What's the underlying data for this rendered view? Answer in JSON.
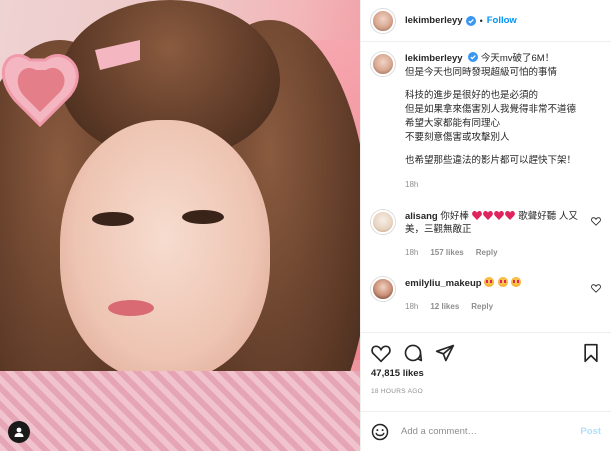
{
  "post": {
    "username": "lekimberleyy",
    "follow_label": "Follow",
    "separator": "•"
  },
  "caption": {
    "username": "lekimberleyy",
    "lines": [
      "今天mv破了6M！",
      "但是今天也同時發現超級可怕的事情",
      "",
      "科技的進步是很好的也是必須的",
      "但是如果拿來傷害別人我覺得非常不道德",
      "希望大家都能有同理心",
      "不要刻意傷害或攻擊別人",
      "",
      "也希望那些違法的影片都可以趕快下架！"
    ],
    "time": "18h"
  },
  "comments": [
    {
      "username": "alisang",
      "text_before": "你好棒",
      "text_after": "歌聲好聽 人又美，三觀無敵正",
      "time": "18h",
      "likes": "157 likes",
      "reply": "Reply"
    },
    {
      "username": "emilyliu_makeup",
      "text": "",
      "time": "18h",
      "likes": "12 likes",
      "reply": "Reply"
    }
  ],
  "stats": {
    "likes": "47,815 likes",
    "time": "18 HOURS AGO"
  },
  "add_comment": {
    "placeholder": "Add a comment…",
    "post_label": "Post"
  },
  "icons": {
    "verified": "verified-badge-icon",
    "like": "heart-icon",
    "comment": "comment-icon",
    "share": "share-icon",
    "save": "bookmark-icon",
    "emoji": "emoji-icon",
    "tag": "user-tag-icon"
  },
  "colors": {
    "accent": "#0095f6",
    "muted": "#8e8e8e",
    "post_disabled": "#b2dffc"
  }
}
